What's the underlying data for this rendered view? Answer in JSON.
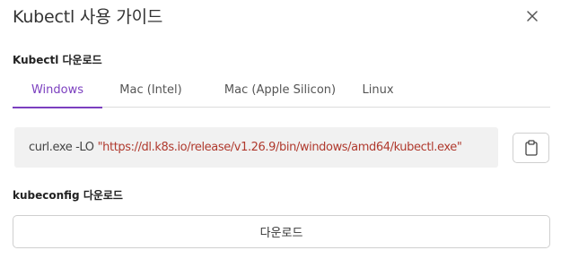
{
  "dialog": {
    "title": "Kubectl 사용 가이드",
    "close_icon": "close-icon"
  },
  "kubectl_section": {
    "label": "Kubectl 다운로드",
    "tabs": [
      {
        "label": "Windows",
        "active": true
      },
      {
        "label": "Mac (Intel)",
        "active": false
      },
      {
        "label": "Mac (Apple Silicon)",
        "active": false
      },
      {
        "label": "Linux",
        "active": false
      }
    ],
    "command": {
      "prefix": "curl.exe -LO",
      "url": "\"https://dl.k8s.io/release/v1.26.9/bin/windows/amd64/kubectl.exe\""
    },
    "copy_icon": "clipboard-icon"
  },
  "kubeconfig_section": {
    "label": "kubeconfig 다운로드",
    "download_label": "다운로드"
  },
  "colors": {
    "accent": "#7b3fbf",
    "url_text": "#b03a2e",
    "code_background": "#f1f1f1"
  }
}
